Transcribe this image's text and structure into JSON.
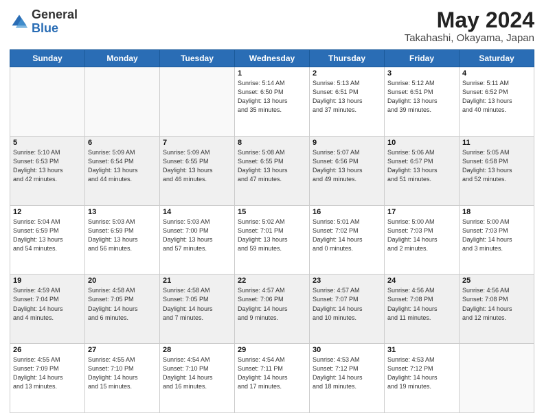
{
  "header": {
    "logo_general": "General",
    "logo_blue": "Blue",
    "title": "May 2024",
    "subtitle": "Takahashi, Okayama, Japan"
  },
  "days_of_week": [
    "Sunday",
    "Monday",
    "Tuesday",
    "Wednesday",
    "Thursday",
    "Friday",
    "Saturday"
  ],
  "weeks": [
    {
      "shaded": false,
      "days": [
        {
          "num": "",
          "info": ""
        },
        {
          "num": "",
          "info": ""
        },
        {
          "num": "",
          "info": ""
        },
        {
          "num": "1",
          "info": "Sunrise: 5:14 AM\nSunset: 6:50 PM\nDaylight: 13 hours\nand 35 minutes."
        },
        {
          "num": "2",
          "info": "Sunrise: 5:13 AM\nSunset: 6:51 PM\nDaylight: 13 hours\nand 37 minutes."
        },
        {
          "num": "3",
          "info": "Sunrise: 5:12 AM\nSunset: 6:51 PM\nDaylight: 13 hours\nand 39 minutes."
        },
        {
          "num": "4",
          "info": "Sunrise: 5:11 AM\nSunset: 6:52 PM\nDaylight: 13 hours\nand 40 minutes."
        }
      ]
    },
    {
      "shaded": true,
      "days": [
        {
          "num": "5",
          "info": "Sunrise: 5:10 AM\nSunset: 6:53 PM\nDaylight: 13 hours\nand 42 minutes."
        },
        {
          "num": "6",
          "info": "Sunrise: 5:09 AM\nSunset: 6:54 PM\nDaylight: 13 hours\nand 44 minutes."
        },
        {
          "num": "7",
          "info": "Sunrise: 5:09 AM\nSunset: 6:55 PM\nDaylight: 13 hours\nand 46 minutes."
        },
        {
          "num": "8",
          "info": "Sunrise: 5:08 AM\nSunset: 6:55 PM\nDaylight: 13 hours\nand 47 minutes."
        },
        {
          "num": "9",
          "info": "Sunrise: 5:07 AM\nSunset: 6:56 PM\nDaylight: 13 hours\nand 49 minutes."
        },
        {
          "num": "10",
          "info": "Sunrise: 5:06 AM\nSunset: 6:57 PM\nDaylight: 13 hours\nand 51 minutes."
        },
        {
          "num": "11",
          "info": "Sunrise: 5:05 AM\nSunset: 6:58 PM\nDaylight: 13 hours\nand 52 minutes."
        }
      ]
    },
    {
      "shaded": false,
      "days": [
        {
          "num": "12",
          "info": "Sunrise: 5:04 AM\nSunset: 6:59 PM\nDaylight: 13 hours\nand 54 minutes."
        },
        {
          "num": "13",
          "info": "Sunrise: 5:03 AM\nSunset: 6:59 PM\nDaylight: 13 hours\nand 56 minutes."
        },
        {
          "num": "14",
          "info": "Sunrise: 5:03 AM\nSunset: 7:00 PM\nDaylight: 13 hours\nand 57 minutes."
        },
        {
          "num": "15",
          "info": "Sunrise: 5:02 AM\nSunset: 7:01 PM\nDaylight: 13 hours\nand 59 minutes."
        },
        {
          "num": "16",
          "info": "Sunrise: 5:01 AM\nSunset: 7:02 PM\nDaylight: 14 hours\nand 0 minutes."
        },
        {
          "num": "17",
          "info": "Sunrise: 5:00 AM\nSunset: 7:03 PM\nDaylight: 14 hours\nand 2 minutes."
        },
        {
          "num": "18",
          "info": "Sunrise: 5:00 AM\nSunset: 7:03 PM\nDaylight: 14 hours\nand 3 minutes."
        }
      ]
    },
    {
      "shaded": true,
      "days": [
        {
          "num": "19",
          "info": "Sunrise: 4:59 AM\nSunset: 7:04 PM\nDaylight: 14 hours\nand 4 minutes."
        },
        {
          "num": "20",
          "info": "Sunrise: 4:58 AM\nSunset: 7:05 PM\nDaylight: 14 hours\nand 6 minutes."
        },
        {
          "num": "21",
          "info": "Sunrise: 4:58 AM\nSunset: 7:05 PM\nDaylight: 14 hours\nand 7 minutes."
        },
        {
          "num": "22",
          "info": "Sunrise: 4:57 AM\nSunset: 7:06 PM\nDaylight: 14 hours\nand 9 minutes."
        },
        {
          "num": "23",
          "info": "Sunrise: 4:57 AM\nSunset: 7:07 PM\nDaylight: 14 hours\nand 10 minutes."
        },
        {
          "num": "24",
          "info": "Sunrise: 4:56 AM\nSunset: 7:08 PM\nDaylight: 14 hours\nand 11 minutes."
        },
        {
          "num": "25",
          "info": "Sunrise: 4:56 AM\nSunset: 7:08 PM\nDaylight: 14 hours\nand 12 minutes."
        }
      ]
    },
    {
      "shaded": false,
      "days": [
        {
          "num": "26",
          "info": "Sunrise: 4:55 AM\nSunset: 7:09 PM\nDaylight: 14 hours\nand 13 minutes."
        },
        {
          "num": "27",
          "info": "Sunrise: 4:55 AM\nSunset: 7:10 PM\nDaylight: 14 hours\nand 15 minutes."
        },
        {
          "num": "28",
          "info": "Sunrise: 4:54 AM\nSunset: 7:10 PM\nDaylight: 14 hours\nand 16 minutes."
        },
        {
          "num": "29",
          "info": "Sunrise: 4:54 AM\nSunset: 7:11 PM\nDaylight: 14 hours\nand 17 minutes."
        },
        {
          "num": "30",
          "info": "Sunrise: 4:53 AM\nSunset: 7:12 PM\nDaylight: 14 hours\nand 18 minutes."
        },
        {
          "num": "31",
          "info": "Sunrise: 4:53 AM\nSunset: 7:12 PM\nDaylight: 14 hours\nand 19 minutes."
        },
        {
          "num": "",
          "info": ""
        }
      ]
    }
  ]
}
